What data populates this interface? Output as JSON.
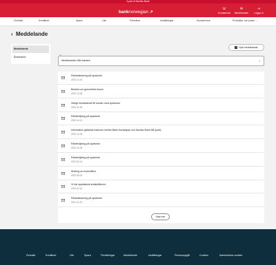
{
  "top_bar": {
    "text": "A part of Nordax Bank"
  },
  "header": {
    "logo_bold": "bank",
    "logo_light": "norwegian",
    "logo_mark": "↗",
    "actions": [
      {
        "icon": "headset-icon",
        "glyph": "☏",
        "label": "Kundservice"
      },
      {
        "icon": "mail-icon",
        "glyph": "✉",
        "label": "Meddelanden"
      },
      {
        "icon": "logout-icon",
        "glyph": "⇥",
        "label": "Logga ut"
      }
    ]
  },
  "nav": {
    "items": [
      {
        "label": "Översikt",
        "chevron": false
      },
      {
        "label": "Kreditkort",
        "chevron": false
      },
      {
        "label": "Spara",
        "chevron": false
      },
      {
        "label": "Lån",
        "chevron": false
      },
      {
        "label": "Förmåner",
        "chevron": false
      },
      {
        "label": "Inställningar",
        "chevron": false
      },
      {
        "label": "Kundservice",
        "chevron": false
      },
      {
        "label": "Produkter och priser",
        "chevron": true
      }
    ]
  },
  "page": {
    "back_glyph": "‹",
    "title": "Meddelande"
  },
  "sidebar": {
    "items": [
      {
        "label": "Meddelande",
        "active": true
      },
      {
        "label": "Årsbesked",
        "active": false
      }
    ]
  },
  "toolbar": {
    "new_message_label": "Nytt meddelande",
    "plus": "+"
  },
  "filter": {
    "label": "Vy",
    "value": "Meddelanden från banken",
    "chevron": "⌄"
  },
  "messages": [
    {
      "subject": "Räntesänkning på spartonto",
      "date": "2022-12-14"
    },
    {
      "subject": "Besked om genomförd fusion",
      "date": "2022-12-08"
    },
    {
      "subject": "Viktigt meddelande till kunder med spartonto",
      "date": "2022-11-28"
    },
    {
      "subject": "Räntehöjning på spartonto",
      "date": "2022-11-04"
    },
    {
      "subject": "Information gällande fusionen mellan Bank Norwegian och Nordax Bank AB (publ)",
      "date": "2022-10-26"
    },
    {
      "subject": "Räntehöjning på spartonto",
      "date": "2022-10-05"
    },
    {
      "subject": "Räntehöjning på spartonto",
      "date": "2022-09-13"
    },
    {
      "subject": "Ändring av kontovillkor",
      "date": "2022-08-02"
    },
    {
      "subject": "Vi har uppdaterat artalsvillkoren",
      "date": "2022-02-01"
    },
    {
      "subject": "Räntesänkning på spartonto",
      "date": "2021-11-29"
    }
  ],
  "load_more_label": "Visa mer",
  "footer": {
    "items": [
      "Översikt",
      "Kreditkort",
      "Lån",
      "Spara",
      "Försäkringar",
      "Meddelande",
      "Inställningar",
      "Personuppgift",
      "Cookies",
      "Administrera cookies"
    ]
  },
  "colors": {
    "brand_red": "#d81e34",
    "footer_navy": "#0e2e3d",
    "page_bg": "#f2f2f2"
  }
}
